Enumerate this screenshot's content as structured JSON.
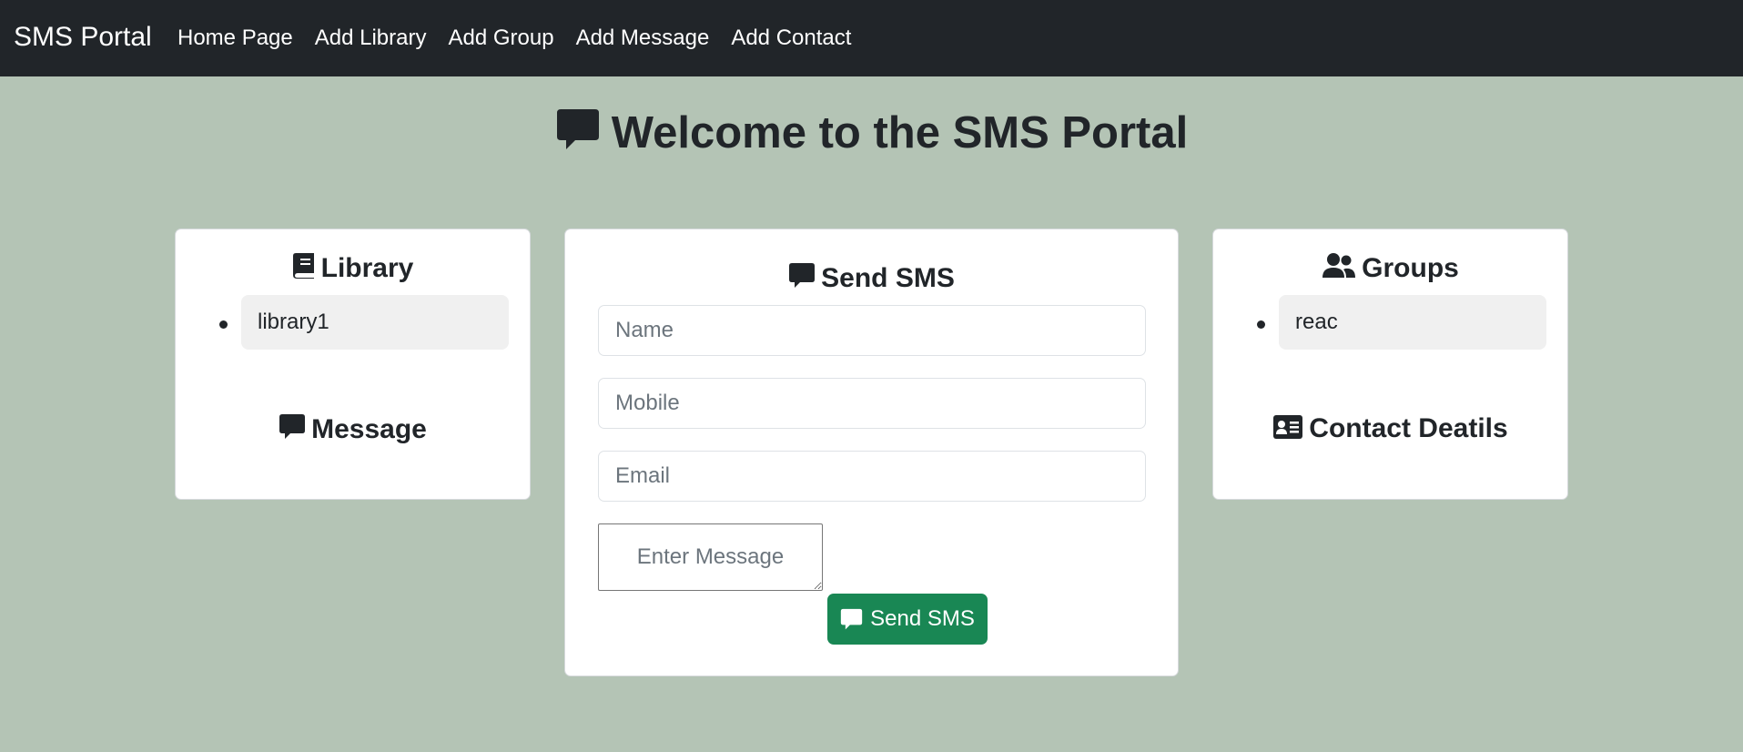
{
  "navbar": {
    "brand": "SMS Portal",
    "links": [
      "Home Page",
      "Add Library",
      "Add Group",
      "Add Message",
      "Add Contact"
    ]
  },
  "page": {
    "title": "Welcome to the SMS Portal",
    "title_icon": "comment-icon"
  },
  "library_card": {
    "heading": "Library",
    "icon": "book-icon",
    "items": [
      "library1"
    ],
    "message_heading": "Message",
    "message_icon": "comment-icon"
  },
  "send_card": {
    "heading": "Send SMS",
    "icon": "comment-icon",
    "name_placeholder": "Name",
    "mobile_placeholder": "Mobile",
    "email_placeholder": "Email",
    "message_placeholder": "Enter Message",
    "button_label": "Send SMS"
  },
  "groups_card": {
    "heading": "Groups",
    "icon": "users-icon",
    "items": [
      "reac"
    ],
    "contact_heading": "Contact Deatils",
    "contact_icon": "address-card-icon"
  },
  "colors": {
    "navbar_bg": "#212529",
    "page_bg": "#b4c4b5",
    "button_green": "#198754",
    "list_item_bg": "#f0f0f0"
  }
}
